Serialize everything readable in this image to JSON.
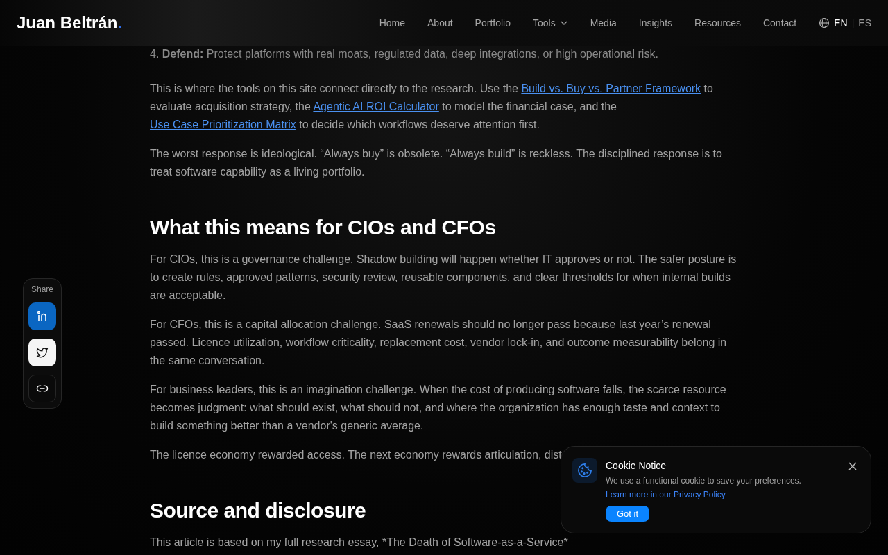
{
  "header": {
    "logo": "Juan Beltrán",
    "logo_mark": ".",
    "nav": [
      {
        "label": "Home",
        "dropdown": false
      },
      {
        "label": "About",
        "dropdown": false
      },
      {
        "label": "Portfolio",
        "dropdown": false
      },
      {
        "label": "Tools",
        "dropdown": true
      },
      {
        "label": "Media",
        "dropdown": false
      },
      {
        "label": "Insights",
        "dropdown": false
      },
      {
        "label": "Resources",
        "dropdown": false
      },
      {
        "label": "Contact",
        "dropdown": false
      }
    ],
    "languages": [
      {
        "label": "EN",
        "selected": true
      },
      {
        "label": "ES",
        "selected": false
      }
    ],
    "language_separator": "|"
  },
  "article": {
    "blocks": [
      {
        "kind": "list_item",
        "text": "4. **Defend:** Protect platforms with real moats, regulated data, deep integrations, or high operational risk."
      },
      {
        "kind": "linked",
        "parts": [
          {
            "text": "This is where the tools on this site connect directly to the research. Use the ",
            "link": false
          },
          {
            "text": "Build vs. Buy vs. Partner Framework",
            "link": true
          },
          {
            "text": " to evaluate acquisition strategy, the ",
            "link": false
          },
          {
            "text": "Agentic AI ROI Calculator",
            "link": true
          },
          {
            "text": " to model the financial case, and the ",
            "link": false
          },
          {
            "text": "Use Case Prioritization Matrix",
            "link": true
          },
          {
            "text": " to decide which workflows deserve attention first.",
            "link": false
          }
        ]
      },
      {
        "kind": "paragraph",
        "text": "The worst response is ideological. “Always buy” is obsolete. “Always build” is reckless. The disciplined response is to treat software capability as a living portfolio."
      },
      {
        "kind": "heading",
        "text": "What this means for CIOs and CFOs"
      },
      {
        "kind": "paragraph",
        "text": "For CIOs, this is a governance challenge. Shadow building will happen whether IT approves or not. The safer posture is to create rules, approved patterns, security review, reusable components, and clear thresholds for when internal builds are acceptable."
      },
      {
        "kind": "paragraph",
        "text": "For CFOs, this is a capital allocation challenge. SaaS renewals should no longer pass because last year’s renewal passed. Licence utilization, workflow criticality, replacement cost, vendor lock-in, and outcome measurability belong in the same conversation."
      },
      {
        "kind": "paragraph",
        "text": "For business leaders, this is an imagination challenge. When the cost of producing software falls, the scarce resource becomes judgment: what should exist, what should not, and where the organization has enough taste and context to build something better than a vendor's generic average."
      },
      {
        "kind": "paragraph",
        "text": "The licence economy rewarded access. The next economy rewards articulation, dist"
      },
      {
        "kind": "heading",
        "text": "Source and disclosure"
      },
      {
        "kind": "paragraph",
        "text": "This article is based on my full research essay, *The Death of Software-as-a-Service*"
      }
    ]
  },
  "share": {
    "label": "Share",
    "buttons": [
      {
        "kind": "linkedin"
      },
      {
        "kind": "twitter"
      },
      {
        "kind": "link"
      }
    ]
  },
  "cookie": {
    "title": "Cookie Notice",
    "text": "We use a functional cookie to save your preferences. ",
    "link": "Learn more in our Privacy Policy",
    "button": "Got it"
  }
}
